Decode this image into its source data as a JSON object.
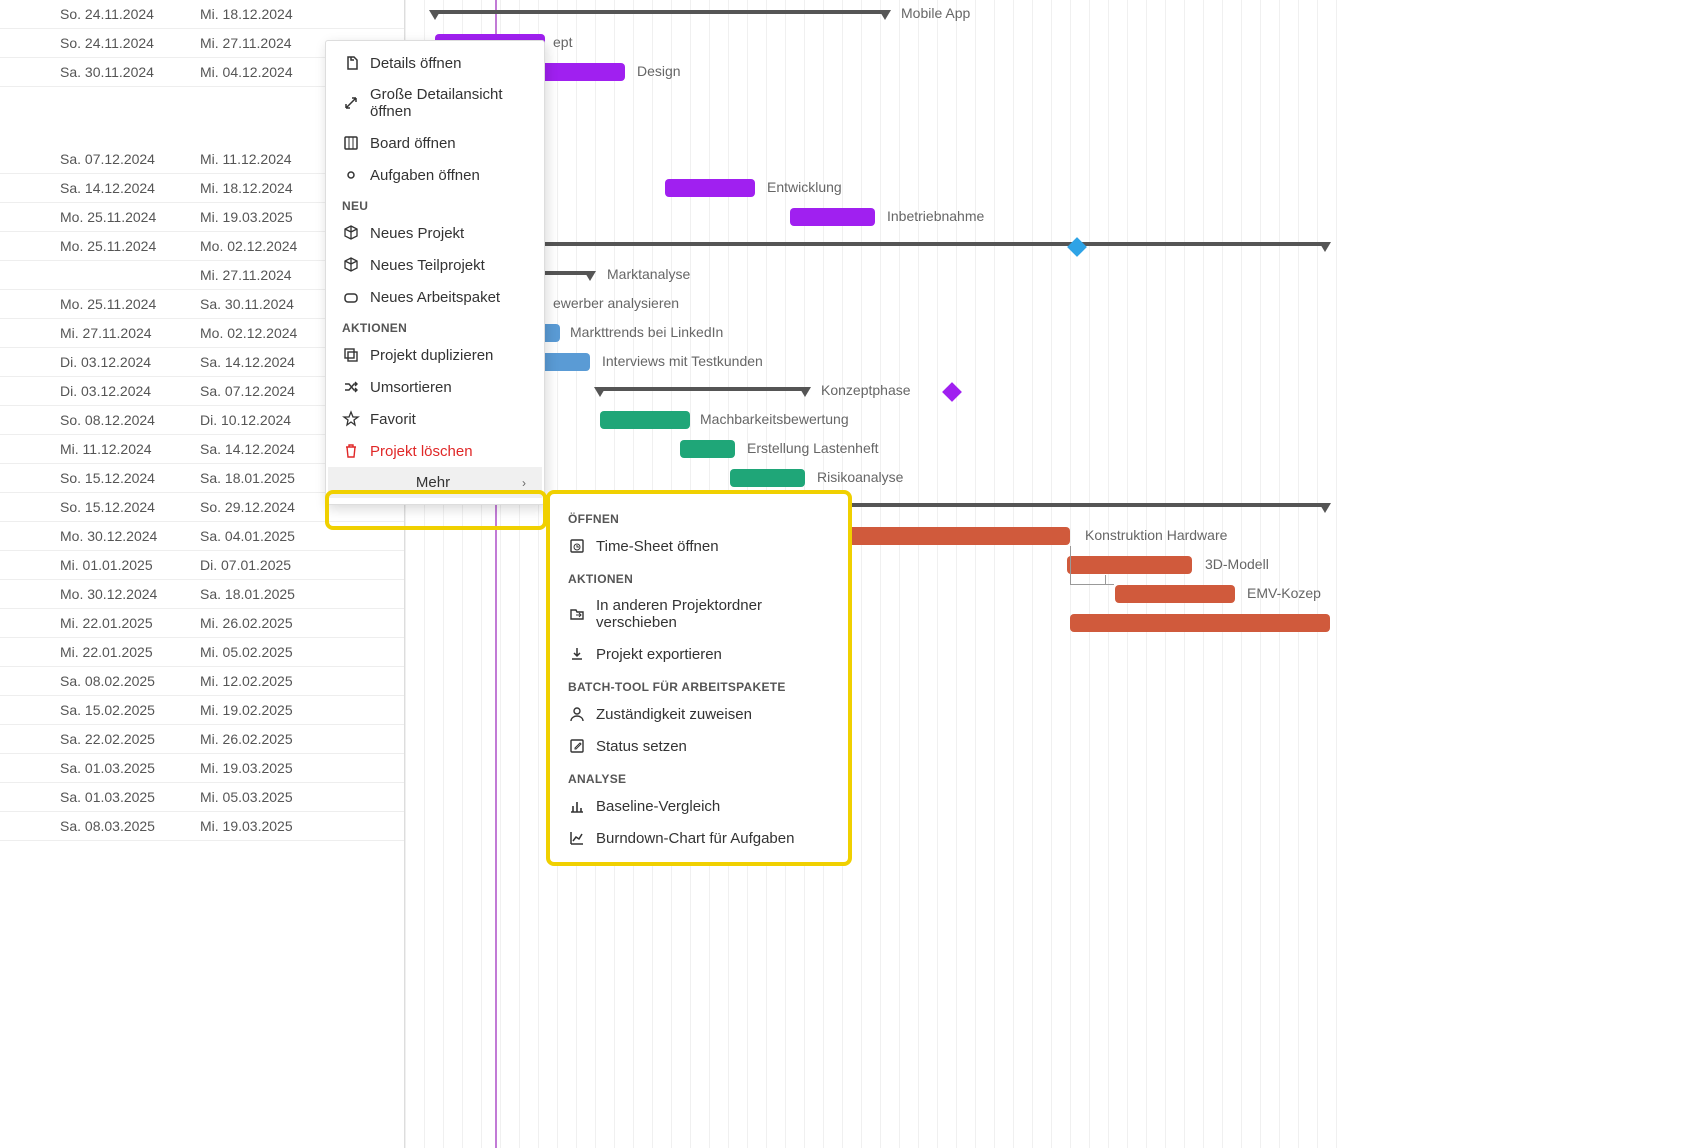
{
  "date_rows": [
    {
      "c1": "So. 24.11.2024",
      "c2": "Mi. 18.12.2024"
    },
    {
      "c1": "So. 24.11.2024",
      "c2": "Mi. 27.11.2024"
    },
    {
      "c1": "Sa. 30.11.2024",
      "c2": "Mi. 04.12.2024"
    },
    {
      "spacer": true
    },
    {
      "c1": "Sa. 07.12.2024",
      "c2": "Mi. 11.12.2024"
    },
    {
      "c1": "Sa. 14.12.2024",
      "c2": "Mi. 18.12.2024"
    },
    {
      "c1": "Mo. 25.11.2024",
      "c2": "Mi. 19.03.2025"
    },
    {
      "c1": "Mo. 25.11.2024",
      "c2": "Mo. 02.12.2024"
    },
    {
      "c1": "",
      "c2": "Mi. 27.11.2024"
    },
    {
      "c1": "Mo. 25.11.2024",
      "c2": "Sa. 30.11.2024"
    },
    {
      "c1": "Mi. 27.11.2024",
      "c2": "Mo. 02.12.2024"
    },
    {
      "c1": "Di. 03.12.2024",
      "c2": "Sa. 14.12.2024"
    },
    {
      "c1": "Di. 03.12.2024",
      "c2": "Sa. 07.12.2024"
    },
    {
      "c1": "So. 08.12.2024",
      "c2": "Di. 10.12.2024"
    },
    {
      "c1": "Mi. 11.12.2024",
      "c2": "Sa. 14.12.2024"
    },
    {
      "c1": "So. 15.12.2024",
      "c2": "Sa. 18.01.2025"
    },
    {
      "c1": "So. 15.12.2024",
      "c2": "So. 29.12.2024"
    },
    {
      "c1": "Mo. 30.12.2024",
      "c2": "Sa. 04.01.2025"
    },
    {
      "c1": "Mi. 01.01.2025",
      "c2": "Di. 07.01.2025"
    },
    {
      "c1": "Mo. 30.12.2024",
      "c2": "Sa. 18.01.2025"
    },
    {
      "c1": "Mi. 22.01.2025",
      "c2": "Mi. 26.02.2025"
    },
    {
      "c1": "Mi. 22.01.2025",
      "c2": "Mi. 05.02.2025"
    },
    {
      "c1": "Sa. 08.02.2025",
      "c2": "Mi. 12.02.2025"
    },
    {
      "c1": "Sa. 15.02.2025",
      "c2": "Mi. 19.02.2025"
    },
    {
      "c1": "Sa. 22.02.2025",
      "c2": "Mi. 26.02.2025"
    },
    {
      "c1": "Sa. 01.03.2025",
      "c2": "Mi. 19.03.2025"
    },
    {
      "c1": "Sa. 01.03.2025",
      "c2": "Mi. 05.03.2025"
    },
    {
      "c1": "Sa. 08.03.2025",
      "c2": "Mi. 19.03.2025"
    }
  ],
  "gantt_labels": {
    "mobile_app": "Mobile App",
    "konzept": "ept",
    "design": "Design",
    "entwicklung": "Entwicklung",
    "inbetriebnahme": "Inbetriebnahme",
    "marktanalyse": "Marktanalyse",
    "mitbewerber": "ewerber analysieren",
    "markttrends": "Markttrends bei LinkedIn",
    "interviews": "Interviews mit Testkunden",
    "konzeptphase": "Konzeptphase",
    "machbarkeit": "Machbarkeitsbewertung",
    "lastenheft": "Erstellung Lastenheft",
    "risikoanalyse": "Risikoanalyse",
    "konstruktion": "Konstruktion Hardware",
    "3dmodell": "3D-Modell",
    "emv": "EMV-Kozep"
  },
  "context_menu": {
    "items_top": [
      {
        "icon": "open-details-icon",
        "label": "Details öffnen"
      },
      {
        "icon": "expand-icon",
        "label": "Große Detailansicht öffnen"
      },
      {
        "icon": "board-icon",
        "label": "Board öffnen"
      },
      {
        "icon": "tasks-icon",
        "label": "Aufgaben öffnen"
      }
    ],
    "header_neu": "NEU",
    "items_neu": [
      {
        "icon": "cube-icon",
        "label": "Neues Projekt"
      },
      {
        "icon": "cube-icon",
        "label": "Neues Teilprojekt"
      },
      {
        "icon": "package-icon",
        "label": "Neues Arbeitspaket"
      }
    ],
    "header_aktionen": "AKTIONEN",
    "items_aktionen": [
      {
        "icon": "duplicate-icon",
        "label": "Projekt duplizieren"
      },
      {
        "icon": "shuffle-icon",
        "label": "Umsortieren"
      },
      {
        "icon": "star-icon",
        "label": "Favorit"
      },
      {
        "icon": "trash-icon",
        "label": "Projekt löschen",
        "danger": true
      }
    ],
    "more_label": "Mehr"
  },
  "submenu": {
    "header_oeffnen": "ÖFFNEN",
    "items_oeffnen": [
      {
        "icon": "timesheet-icon",
        "label": "Time-Sheet öffnen"
      }
    ],
    "header_aktionen": "AKTIONEN",
    "items_aktionen": [
      {
        "icon": "folder-move-icon",
        "label": "In anderen Projektordner verschieben"
      },
      {
        "icon": "download-icon",
        "label": "Projekt exportieren"
      }
    ],
    "header_batch": "BATCH-TOOL FÜR ARBEITSPAKETE",
    "items_batch": [
      {
        "icon": "person-icon",
        "label": "Zuständigkeit zuweisen"
      },
      {
        "icon": "edit-icon",
        "label": "Status setzen"
      }
    ],
    "header_analyse": "ANALYSE",
    "items_analyse": [
      {
        "icon": "bar-chart-icon",
        "label": "Baseline-Vergleich"
      },
      {
        "icon": "line-chart-icon",
        "label": "Burndown-Chart für Aufgaben"
      }
    ]
  },
  "colors": {
    "purple": "#a020f0",
    "blue": "#5a9bd5",
    "green": "#1fa678",
    "red": "#d05a3c",
    "highlight_border": "#f0d000"
  }
}
